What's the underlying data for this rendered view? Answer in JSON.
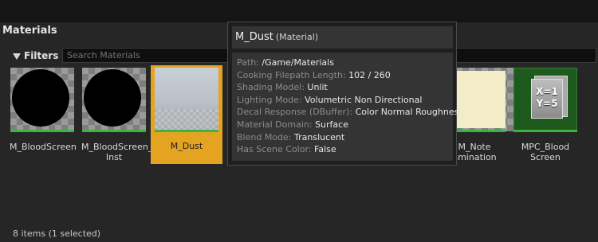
{
  "panel": {
    "title": "Materials",
    "filters_label": "Filters",
    "search_placeholder": "Search Materials",
    "status": "8 items (1 selected)"
  },
  "assets": [
    {
      "label": "M_BloodScreen",
      "type": "material",
      "thumb": "black-circle"
    },
    {
      "label": "M_BloodScreen_\nInst",
      "type": "material-instance",
      "thumb": "black-circle"
    },
    {
      "label": "M_Dust",
      "type": "material",
      "thumb": "dust",
      "selected": true
    },
    {
      "label": "M_Note\namination",
      "type": "material",
      "thumb": "note"
    },
    {
      "label": "MPC_Blood\nScreen",
      "type": "material-parameter-collection",
      "thumb": "x1-y5-icon",
      "icon_text": [
        "X=1",
        "Y=5"
      ]
    }
  ],
  "tooltip": {
    "title": "M_Dust",
    "subtitle": "(Material)",
    "rows": [
      {
        "key": "Path:",
        "value": "/Game/Materials"
      },
      {
        "key": "Cooking Filepath Length:",
        "value": "102 / 260"
      },
      {
        "key": "Shading Model:",
        "value": "Unlit"
      },
      {
        "key": "Lighting Mode:",
        "value": "Volumetric Non Directional"
      },
      {
        "key": "Decal Response (DBuffer):",
        "value": "Color Normal Roughness"
      },
      {
        "key": "Material Domain:",
        "value": "Surface"
      },
      {
        "key": "Blend Mode:",
        "value": "Translucent"
      },
      {
        "key": "Has Scene Color:",
        "value": "False"
      }
    ]
  },
  "colors": {
    "selection": "#e5a322",
    "asset_bar": "#3fb33f",
    "background": "#262626"
  }
}
